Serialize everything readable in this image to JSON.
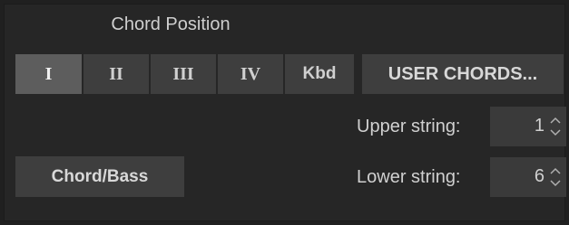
{
  "chord_position": {
    "title": "Chord Position",
    "buttons": [
      {
        "label": "I",
        "selected": true
      },
      {
        "label": "II",
        "selected": false
      },
      {
        "label": "III",
        "selected": false
      },
      {
        "label": "IV",
        "selected": false
      },
      {
        "label": "Kbd",
        "selected": false
      }
    ]
  },
  "user_chords_label": "USER CHORDS...",
  "chord_bass_label": "Chord/Bass",
  "upper_string": {
    "label": "Upper string:",
    "value": "1"
  },
  "lower_string": {
    "label": "Lower string:",
    "value": "6"
  }
}
